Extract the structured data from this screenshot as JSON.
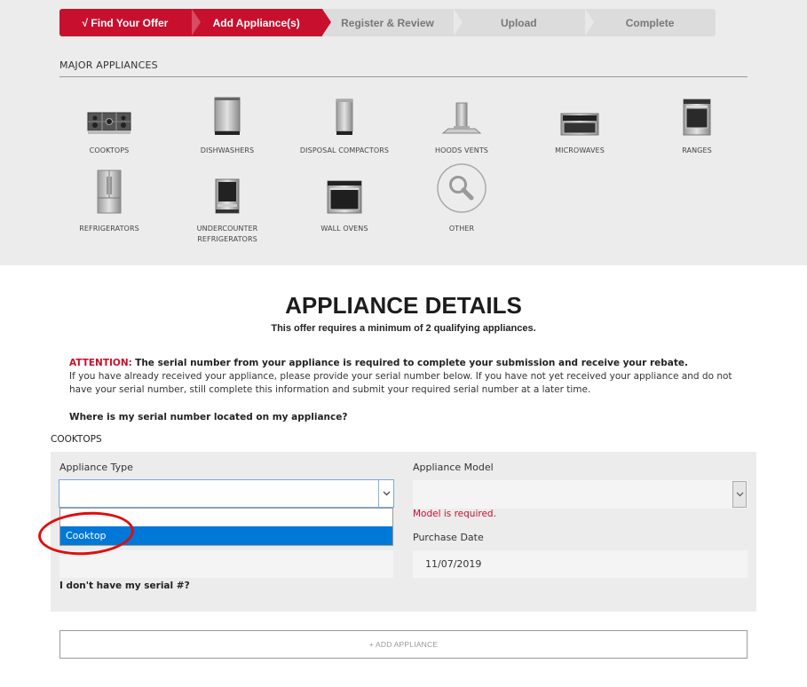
{
  "stepper": {
    "steps": [
      {
        "label": "√ Find Your Offer",
        "state": "done"
      },
      {
        "label": "Add Appliance(s)",
        "state": "active"
      },
      {
        "label": "Register & Review",
        "state": "pending"
      },
      {
        "label": "Upload",
        "state": "pending"
      },
      {
        "label": "Complete",
        "state": "pending"
      }
    ]
  },
  "major_appliances": {
    "title": "MAJOR APPLIANCES",
    "items": [
      {
        "label": "COOKTOPS",
        "icon": "cooktop-icon"
      },
      {
        "label": "DISHWASHERS",
        "icon": "dishwasher-icon"
      },
      {
        "label": "DISPOSAL COMPACTORS",
        "icon": "compactor-icon"
      },
      {
        "label": "HOODS VENTS",
        "icon": "hood-icon"
      },
      {
        "label": "MICROWAVES",
        "icon": "microwave-icon"
      },
      {
        "label": "RANGES",
        "icon": "range-icon"
      },
      {
        "label": "REFRIGERATORS",
        "icon": "refrigerator-icon"
      },
      {
        "label": "UNDERCOUNTER REFRIGERATORS",
        "icon": "undercounter-refrigerator-icon"
      },
      {
        "label": "WALL OVENS",
        "icon": "wall-oven-icon"
      },
      {
        "label": "OTHER",
        "icon": "search-icon"
      }
    ]
  },
  "details": {
    "title": "APPLIANCE DETAILS",
    "subtitle": "This offer requires a minimum of 2 qualifying appliances.",
    "attention_label": "ATTENTION:",
    "attention_strong": "The serial number from your appliance is required to complete your submission and receive your rebate.",
    "attention_body": "If you have already received your appliance, please provide your serial number below. If you have not yet received your appliance and do not have your serial number, still complete this information and submit your required serial number at a later time.",
    "where_link": "Where is my serial number located on my appliance?"
  },
  "form": {
    "category": "COOKTOPS",
    "appliance_type_label": "Appliance Type",
    "appliance_type_value": "",
    "appliance_type_options": [
      "",
      "Cooktop"
    ],
    "appliance_type_highlighted": "Cooktop",
    "appliance_model_label": "Appliance Model",
    "appliance_model_value": "",
    "model_error": "Model is required.",
    "purchase_date_label": "Purchase Date",
    "purchase_date_value": "11/07/2019",
    "serial_value": "",
    "no_serial_link": "I don't have my serial #?"
  },
  "add_button_label": "+ ADD APPLIANCE",
  "colors": {
    "brand_red": "#c8102e",
    "select_highlight": "#0078d7",
    "annotation_red": "#e00d0d"
  }
}
